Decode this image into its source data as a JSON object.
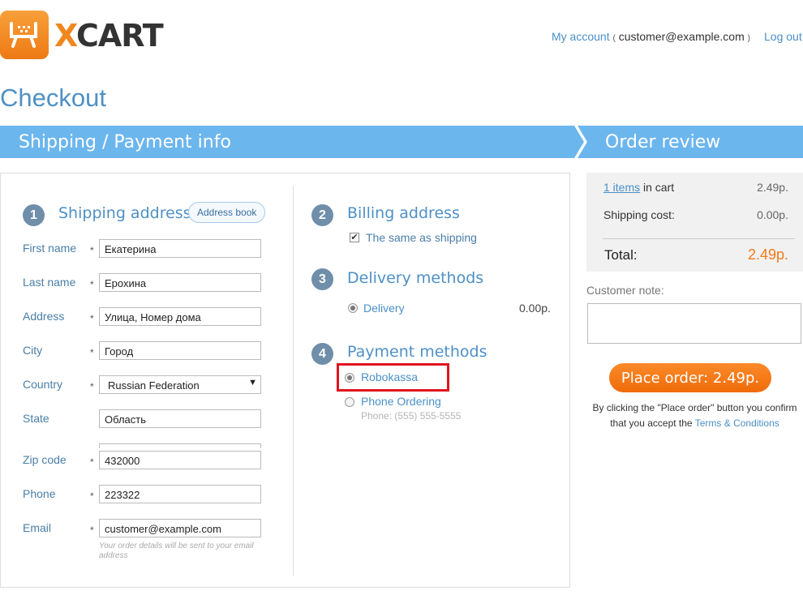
{
  "header": {
    "logo_text_x": "X",
    "logo_text_rest": "CART",
    "my_account": "My account",
    "paren_open": "(",
    "paren_close": ")",
    "email": "customer@example.com",
    "logout": "Log out"
  },
  "page_title": "Checkout",
  "steps": [
    "Shipping / Payment info",
    "Order review"
  ],
  "colors": {
    "accent_blue": "#4e90c6",
    "step_bar": "#6cb6ee",
    "orange": "#f07a18",
    "highlight_red": "#e0141e"
  },
  "shipping": {
    "number": "1",
    "title": "Shipping address",
    "address_book": "Address book",
    "required_mark": "*",
    "fields": {
      "first_name": {
        "label": "First name",
        "value": "Екатерина"
      },
      "last_name": {
        "label": "Last name",
        "value": "Ерохина"
      },
      "address": {
        "label": "Address",
        "value": "Улица, Номер дома"
      },
      "city": {
        "label": "City",
        "value": "Город"
      },
      "country": {
        "label": "Country",
        "value": "Russian Federation"
      },
      "state": {
        "label": "State",
        "value": "Область"
      },
      "zip": {
        "label": "Zip code",
        "value": "432000"
      },
      "phone": {
        "label": "Phone",
        "value": "223322"
      },
      "email": {
        "label": "Email",
        "value": "customer@example.com"
      }
    },
    "email_hint": "Your order details will be sent to your email address"
  },
  "billing": {
    "number": "2",
    "title": "Billing address",
    "same_as_shipping": "The same as shipping",
    "same_checked": true
  },
  "delivery": {
    "number": "3",
    "title": "Delivery methods",
    "option": "Delivery",
    "price": "0.00р."
  },
  "payment": {
    "number": "4",
    "title": "Payment methods",
    "options": [
      {
        "label": "Robokassa",
        "selected": true
      },
      {
        "label": "Phone Ordering",
        "sub": "Phone: (555) 555-5555",
        "selected": false
      }
    ]
  },
  "summary": {
    "items_link": "1 items",
    "items_suffix": " in cart",
    "items_value": "2.49р.",
    "shipping_label": "Shipping cost:",
    "shipping_value": "0.00р.",
    "total_label": "Total:",
    "total_value": "2.49р."
  },
  "customer_note_label": "Customer note:",
  "place_order": "Place order: 2.49р.",
  "terms": {
    "line1": "By clicking the \"Place order\" button you confirm",
    "line2_prefix": "that you accept the ",
    "link": "Terms & Conditions"
  }
}
